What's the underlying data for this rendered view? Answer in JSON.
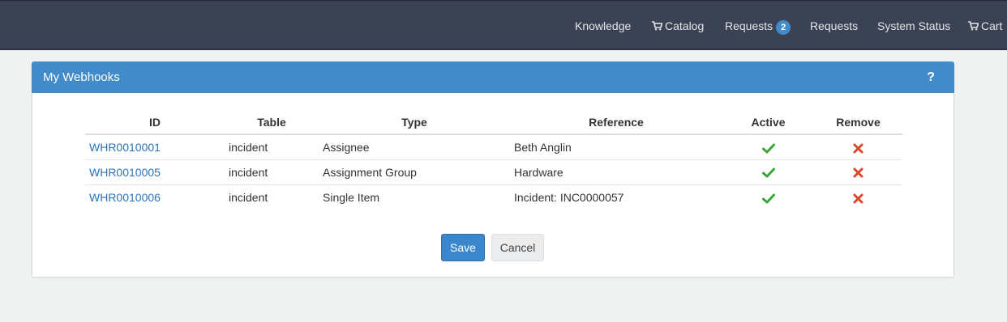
{
  "nav": {
    "knowledge": "Knowledge",
    "catalog": "Catalog",
    "requests_badge_label": "Requests",
    "requests_badge_count": "2",
    "requests": "Requests",
    "system_status": "System Status",
    "cart": "Cart"
  },
  "panel": {
    "title": "My Webhooks",
    "help": "?"
  },
  "table": {
    "headers": [
      "ID",
      "Table",
      "Type",
      "Reference",
      "Active",
      "Remove"
    ],
    "rows": [
      {
        "id": "WHR0010001",
        "table": "incident",
        "type": "Assignee",
        "reference": "Beth Anglin",
        "active": true
      },
      {
        "id": "WHR0010005",
        "table": "incident",
        "type": "Assignment Group",
        "reference": "Hardware",
        "active": true
      },
      {
        "id": "WHR0010006",
        "table": "incident",
        "type": "Single Item",
        "reference": "Incident: INC0000057",
        "active": true
      }
    ]
  },
  "buttons": {
    "save": "Save",
    "cancel": "Cancel"
  },
  "colors": {
    "navbar": "#3b4253",
    "panel_header": "#428bca",
    "active_check": "#3aa63a",
    "remove_x": "#d9482b"
  },
  "icons": {
    "catalog": "cart-icon",
    "cart": "cart-icon",
    "active": "check-icon",
    "remove": "x-icon",
    "help": "question-icon"
  }
}
